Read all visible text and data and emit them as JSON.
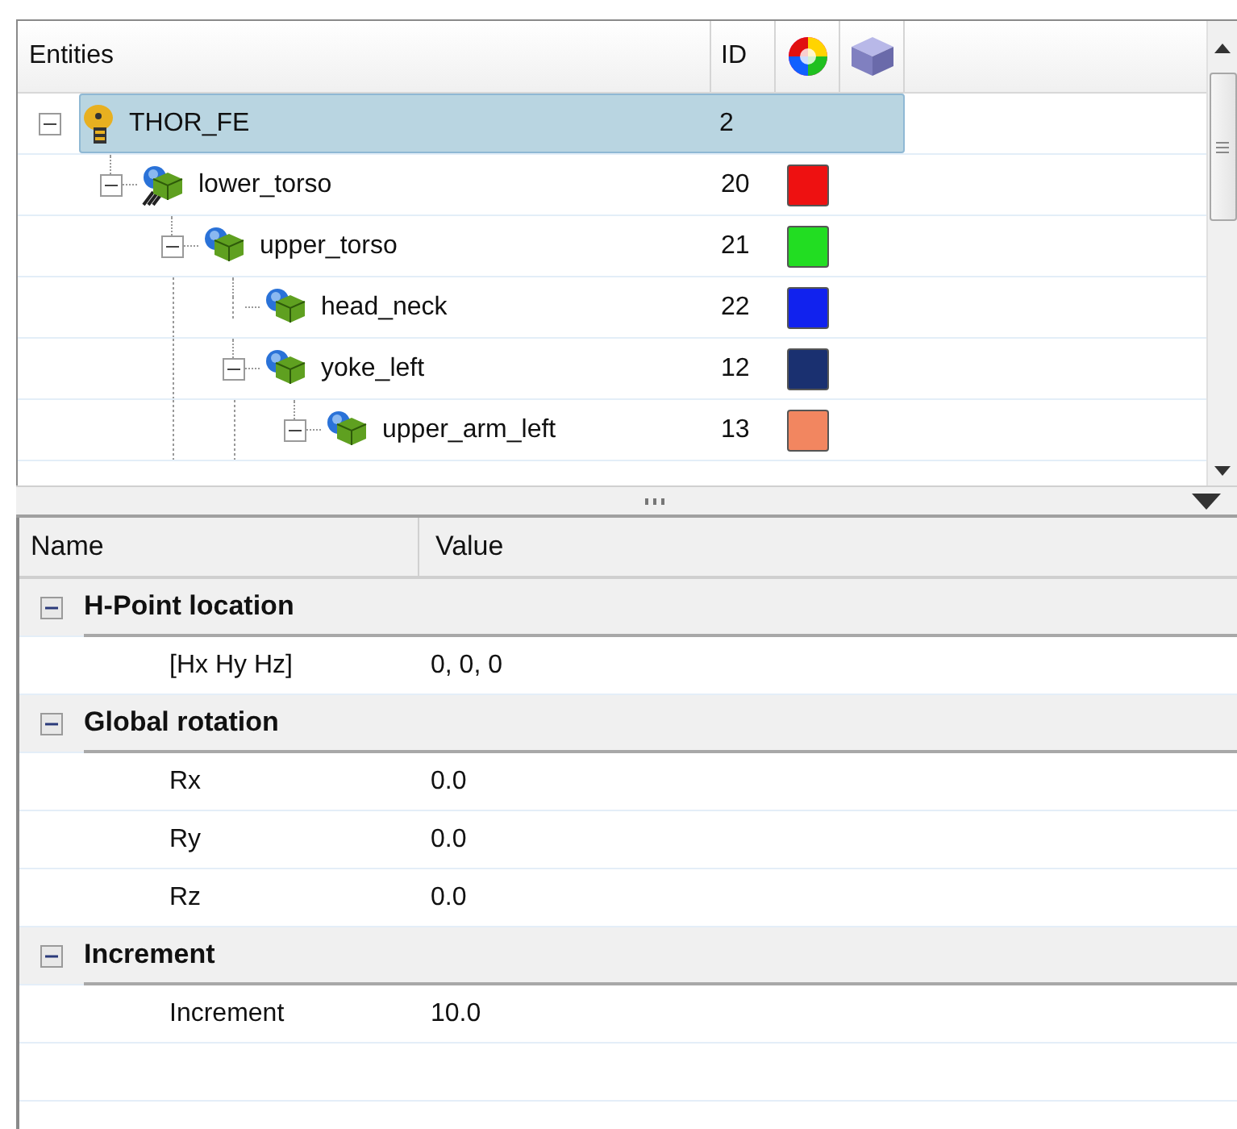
{
  "tree": {
    "columns": [
      {
        "label": "Entities"
      },
      {
        "label": "ID"
      }
    ],
    "items": [
      {
        "name": "THOR_FE",
        "id": "2",
        "kind": "model",
        "selected": true,
        "expanded": true,
        "children": [
          {
            "name": "lower_torso",
            "id": "20",
            "kind": "assembly",
            "color": "#ee1111",
            "selected": false,
            "expanded": true,
            "children": [
              {
                "name": "upper_torso",
                "id": "21",
                "kind": "component",
                "color": "#22dd22",
                "selected": false,
                "expanded": true,
                "children": [
                  {
                    "name": "head_neck",
                    "id": "22",
                    "kind": "component",
                    "color": "#1122ee",
                    "selected": false
                  },
                  {
                    "name": "yoke_left",
                    "id": "12",
                    "kind": "component",
                    "color": "#1a3070",
                    "selected": false,
                    "expanded": true,
                    "children": [
                      {
                        "name": "upper_arm_left",
                        "id": "13",
                        "kind": "component",
                        "color": "#f28660",
                        "selected": false,
                        "expanded": true
                      }
                    ]
                  }
                ]
              }
            ]
          }
        ]
      }
    ]
  },
  "properties": {
    "columns": [
      {
        "label": "Name"
      },
      {
        "label": "Value"
      }
    ],
    "groups": [
      {
        "label": "H-Point location",
        "expanded": true,
        "rows": [
          {
            "name": "[Hx Hy Hz]",
            "value": "0, 0, 0"
          }
        ]
      },
      {
        "label": "Global rotation",
        "expanded": true,
        "rows": [
          {
            "name": "Rx",
            "value": "0.0"
          },
          {
            "name": "Ry",
            "value": "0.0"
          },
          {
            "name": "Rz",
            "value": "0.0"
          }
        ]
      },
      {
        "label": "Increment",
        "expanded": true,
        "rows": [
          {
            "name": "Increment",
            "value": "10.0"
          }
        ]
      }
    ]
  }
}
